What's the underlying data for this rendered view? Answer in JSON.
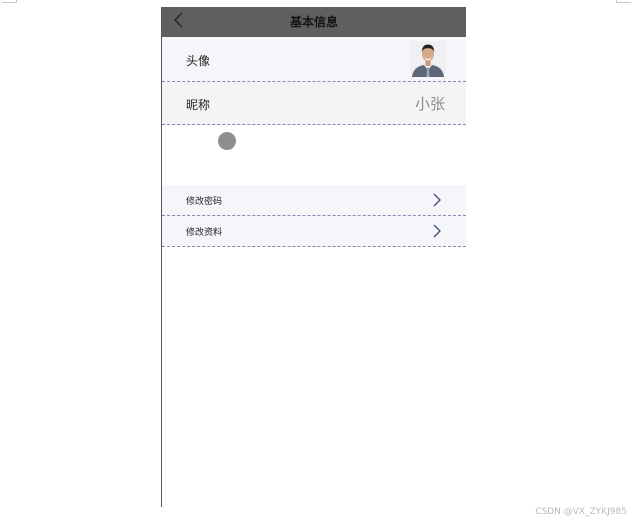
{
  "header": {
    "title": "基本信息",
    "back_icon": "chevron-left-icon"
  },
  "profile": {
    "avatar_label": "头像",
    "nickname_label": "昵称",
    "nickname_value": "小张"
  },
  "menu": {
    "items": [
      {
        "label": "修改密码",
        "icon": "chevron-right-icon"
      },
      {
        "label": "修改资料",
        "icon": "chevron-right-icon"
      }
    ]
  },
  "watermark": "CSDN @VX_ZYKJ985",
  "colors": {
    "nav_bar": "#5f5f5f",
    "row_background": "#f6f6fa",
    "divider": "#7d8fb0",
    "chevron": "#3b4d78",
    "nickname_value": "#8c8c8c"
  }
}
